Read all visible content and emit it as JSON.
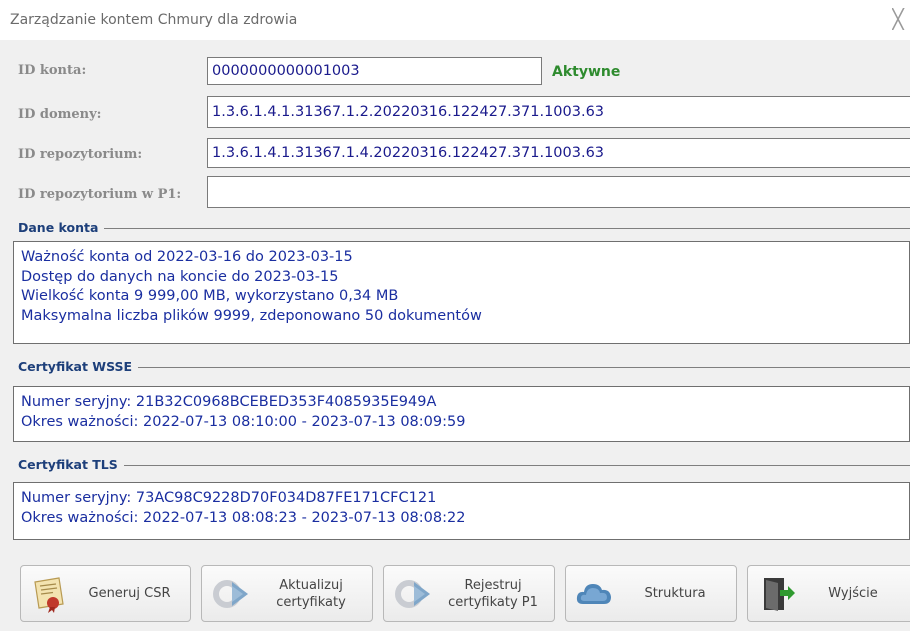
{
  "window": {
    "title": "Zarządzanie kontem Chmury dla zdrowia"
  },
  "form": {
    "account_id_label": "ID konta:",
    "account_id_value": "0000000000001003",
    "account_status": "Aktywne",
    "domain_id_label": "ID domeny:",
    "domain_id_value": "1.3.6.1.4.1.31367.1.2.20220316.122427.371.1003.63",
    "repo_id_label": "ID repozytorium:",
    "repo_id_value": "1.3.6.1.4.1.31367.1.4.20220316.122427.371.1003.63",
    "repo_p1_label": "ID repozytorium w P1:",
    "repo_p1_value": ""
  },
  "account_data": {
    "title": "Dane konta",
    "lines": [
      "Ważność konta od 2022-03-16 do 2023-03-15",
      "Dostęp do danych na koncie do 2023-03-15",
      "Wielkość konta 9 999,00 MB, wykorzystano 0,34 MB",
      "Maksymalna liczba plików 9999, zdeponowano 50 dokumentów"
    ]
  },
  "wsse": {
    "title": "Certyfikat WSSE",
    "lines": [
      "Numer seryjny: 21B32C0968BCEBED353F4085935E949A",
      "Okres ważności: 2022-07-13 08:10:00 - 2023-07-13 08:09:59"
    ]
  },
  "tls": {
    "title": "Certyfikat TLS",
    "lines": [
      "Numer seryjny: 73AC98C9228D70F034D87FE171CFC121",
      "Okres ważności: 2022-07-13 08:08:23 - 2023-07-13 08:08:22"
    ]
  },
  "buttons": {
    "generate_csr": {
      "label": "Generuj CSR",
      "icon": "certificate-icon"
    },
    "update_certs": {
      "label": "Aktualizuj\ncertyfikaty",
      "icon": "refresh-arrow-icon"
    },
    "register_p1": {
      "label": "Rejestruj\ncertyfikaty P1",
      "icon": "register-arrow-icon"
    },
    "structure": {
      "label": "Struktura",
      "icon": "cloud-icon"
    },
    "exit": {
      "label": "Wyjście",
      "icon": "exit-door-icon"
    }
  },
  "colors": {
    "status_active": "#2e8b2e",
    "value_text": "#1a1a8c",
    "section_title": "#1d3f7a"
  }
}
